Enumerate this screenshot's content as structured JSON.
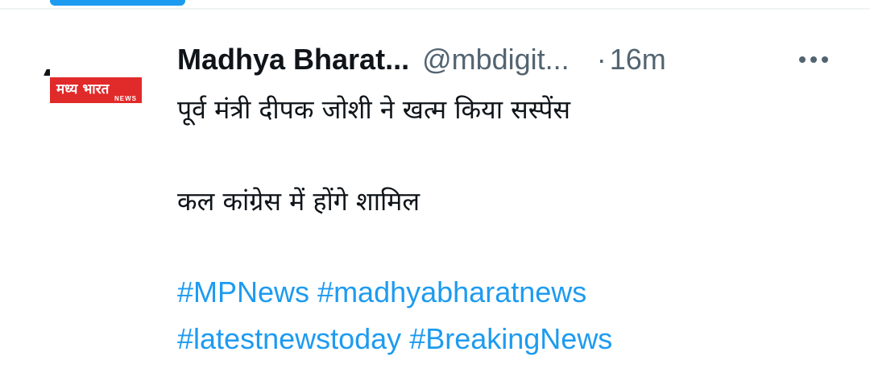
{
  "tweet": {
    "display_name": "Madhya Bharat...",
    "handle": "@mbdigit...",
    "separator": "·",
    "time": "16m",
    "more_label": "More",
    "avatar": {
      "logo_text": "मध्य भारत",
      "logo_sub": "NEWS"
    },
    "body": {
      "line1": "पूर्व मंत्री दीपक जोशी ने खत्म किया सस्पेंस",
      "line2": "कल कांग्रेस में होंगे शामिल"
    },
    "hashtags": [
      "#MPNews",
      "#madhyabharatnews",
      "#latestnewstoday",
      "#BreakingNews"
    ]
  },
  "colors": {
    "link": "#1d9bf0",
    "muted": "#536471",
    "text": "#0f1419",
    "logo_red": "#e12a2a"
  }
}
